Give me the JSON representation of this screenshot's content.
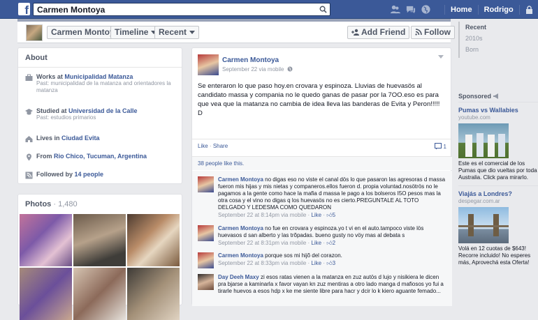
{
  "colors": {
    "brand": "#3b5998",
    "link": "#3b5998",
    "muted": "#9197a3",
    "bg": "#e9eaed"
  },
  "topbar": {
    "search_value": "Carmen Montoya",
    "nav_home": "Home",
    "nav_profile": "Rodrigo"
  },
  "profile_bar": {
    "name": "Carmen Montoya",
    "timeline": "Timeline",
    "recent": "Recent",
    "add_friend": "Add Friend",
    "follow": "Follow"
  },
  "timeline_nav": [
    "Recent",
    "2010s",
    "Born"
  ],
  "about": {
    "title": "About",
    "works_prefix": "Works at ",
    "works_link": "Municipalidad Matanza",
    "works_past": "Past: municipalidad de la matanza and orientadores la matanza",
    "studied_prefix": "Studied at ",
    "studied_link": "Universidad de la Calle",
    "studied_past": "Past: estudios primarios",
    "lives_prefix": "Lives in ",
    "lives_link": "Ciudad Evita",
    "from_prefix": "From ",
    "from_link": "Rio Chico, Tucuman, Argentina",
    "followed_prefix": "Followed by ",
    "followed_link": "14 people"
  },
  "photos": {
    "title": "Photos",
    "count": "1,480"
  },
  "post": {
    "author": "Carmen Montoya",
    "date": "September 22 via mobile",
    "text": "Se enteraron lo que paso hoy.en crovara y espinoza. Lluvias de huevasös al candidato massa y compania no le quedo ganas de pasar por la 7OO.eso es para que vea que la matanza no cambia de idea lleva las banderas de Evita y Peron!!!!!\nD",
    "like": "Like",
    "share": "Share",
    "comment_count": "1",
    "likes_text": "38 people like this."
  },
  "comments": [
    {
      "author": "Carmen Montoya",
      "text": "no digas eso no viste el canal dös lo que pasaron las agresoras d massa fueron mis hijas y mis nietas y companeros.ellos fueron d. propia voluntad.nosötrös no le pagamos a la gente como hace la mafia d massa le pago a los bolseros I5O pesos mas la otra cosa y el vino no digas q los huevasös no es cierto.PREGUNTALE AL TOTO DELGADO Y LEDESMA COMO QUEDARON",
      "time": "September 22 at 8:14pm via mobile",
      "like": "Like",
      "likes": "5"
    },
    {
      "author": "Carmen Montoya",
      "text": "no fue en crovara y espinoza.yo t vi en el auto.tampoco viste lös huevasos d san alberto y las trõpadas. bueno gusty no vöy mas al debata s",
      "time": "September 22 at 8:31pm via mobile",
      "like": "Like",
      "likes": "2"
    },
    {
      "author": "Carmen Montoya",
      "text": "porque sos mi hijõ del corazon.",
      "time": "September 22 at 8:33pm via mobile",
      "like": "Like",
      "likes": "3"
    },
    {
      "author": "Day Deeh Maxy",
      "text": "zi esos ratas vienen a la matanza en zuz autös d lujo y nisikiera le dicen pra bjarse a kaminarla x favor vayan kn zuz mentiras a otro lado manga d mafiosos yo fui a tirarle huevos a esos hdp x ke me siente libre para hacr y dcir lo k kiero aguante femado...",
      "time": "",
      "like": "",
      "likes": ""
    }
  ],
  "sponsored": {
    "title": "Sponsored",
    "ad1_title": "Pumas vs Wallabies",
    "ad1_domain": "youtube.com",
    "ad1_text": "Este es el comercial de los Pumas que dio vueltas por toda Australia. Click para mirarlo.",
    "ad2_title": "Viajás a Londres?",
    "ad2_domain": "despegar.com.ar",
    "ad2_text": "Volá en 12 cuotas de $643! Recorre incluido! No esperes más, Aprovechá esta Oferta!"
  }
}
